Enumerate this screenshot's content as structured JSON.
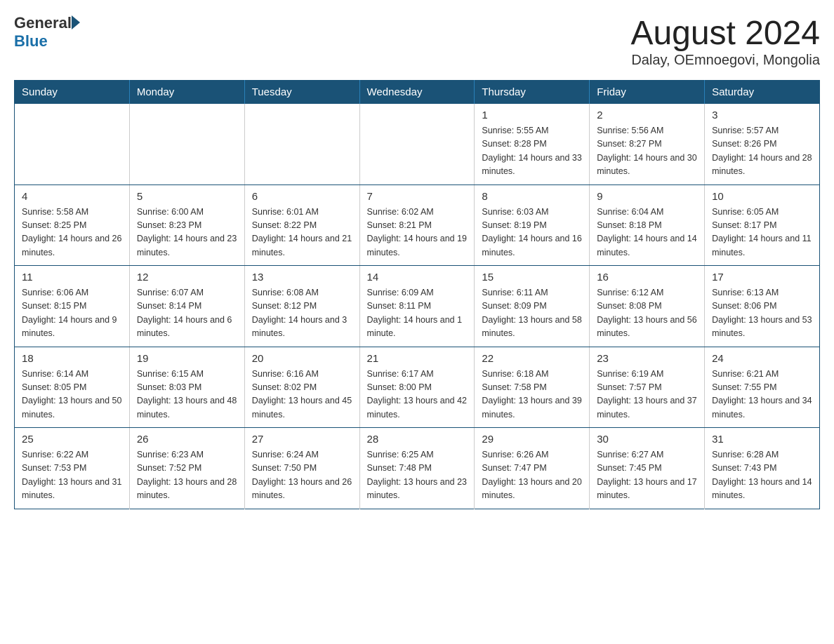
{
  "header": {
    "title": "August 2024",
    "subtitle": "Dalay, OEmnoegovi, Mongolia",
    "logo_general": "General",
    "logo_blue": "Blue"
  },
  "days_of_week": [
    "Sunday",
    "Monday",
    "Tuesday",
    "Wednesday",
    "Thursday",
    "Friday",
    "Saturday"
  ],
  "weeks": [
    [
      {
        "day": "",
        "info": ""
      },
      {
        "day": "",
        "info": ""
      },
      {
        "day": "",
        "info": ""
      },
      {
        "day": "",
        "info": ""
      },
      {
        "day": "1",
        "info": "Sunrise: 5:55 AM\nSunset: 8:28 PM\nDaylight: 14 hours and 33 minutes."
      },
      {
        "day": "2",
        "info": "Sunrise: 5:56 AM\nSunset: 8:27 PM\nDaylight: 14 hours and 30 minutes."
      },
      {
        "day": "3",
        "info": "Sunrise: 5:57 AM\nSunset: 8:26 PM\nDaylight: 14 hours and 28 minutes."
      }
    ],
    [
      {
        "day": "4",
        "info": "Sunrise: 5:58 AM\nSunset: 8:25 PM\nDaylight: 14 hours and 26 minutes."
      },
      {
        "day": "5",
        "info": "Sunrise: 6:00 AM\nSunset: 8:23 PM\nDaylight: 14 hours and 23 minutes."
      },
      {
        "day": "6",
        "info": "Sunrise: 6:01 AM\nSunset: 8:22 PM\nDaylight: 14 hours and 21 minutes."
      },
      {
        "day": "7",
        "info": "Sunrise: 6:02 AM\nSunset: 8:21 PM\nDaylight: 14 hours and 19 minutes."
      },
      {
        "day": "8",
        "info": "Sunrise: 6:03 AM\nSunset: 8:19 PM\nDaylight: 14 hours and 16 minutes."
      },
      {
        "day": "9",
        "info": "Sunrise: 6:04 AM\nSunset: 8:18 PM\nDaylight: 14 hours and 14 minutes."
      },
      {
        "day": "10",
        "info": "Sunrise: 6:05 AM\nSunset: 8:17 PM\nDaylight: 14 hours and 11 minutes."
      }
    ],
    [
      {
        "day": "11",
        "info": "Sunrise: 6:06 AM\nSunset: 8:15 PM\nDaylight: 14 hours and 9 minutes."
      },
      {
        "day": "12",
        "info": "Sunrise: 6:07 AM\nSunset: 8:14 PM\nDaylight: 14 hours and 6 minutes."
      },
      {
        "day": "13",
        "info": "Sunrise: 6:08 AM\nSunset: 8:12 PM\nDaylight: 14 hours and 3 minutes."
      },
      {
        "day": "14",
        "info": "Sunrise: 6:09 AM\nSunset: 8:11 PM\nDaylight: 14 hours and 1 minute."
      },
      {
        "day": "15",
        "info": "Sunrise: 6:11 AM\nSunset: 8:09 PM\nDaylight: 13 hours and 58 minutes."
      },
      {
        "day": "16",
        "info": "Sunrise: 6:12 AM\nSunset: 8:08 PM\nDaylight: 13 hours and 56 minutes."
      },
      {
        "day": "17",
        "info": "Sunrise: 6:13 AM\nSunset: 8:06 PM\nDaylight: 13 hours and 53 minutes."
      }
    ],
    [
      {
        "day": "18",
        "info": "Sunrise: 6:14 AM\nSunset: 8:05 PM\nDaylight: 13 hours and 50 minutes."
      },
      {
        "day": "19",
        "info": "Sunrise: 6:15 AM\nSunset: 8:03 PM\nDaylight: 13 hours and 48 minutes."
      },
      {
        "day": "20",
        "info": "Sunrise: 6:16 AM\nSunset: 8:02 PM\nDaylight: 13 hours and 45 minutes."
      },
      {
        "day": "21",
        "info": "Sunrise: 6:17 AM\nSunset: 8:00 PM\nDaylight: 13 hours and 42 minutes."
      },
      {
        "day": "22",
        "info": "Sunrise: 6:18 AM\nSunset: 7:58 PM\nDaylight: 13 hours and 39 minutes."
      },
      {
        "day": "23",
        "info": "Sunrise: 6:19 AM\nSunset: 7:57 PM\nDaylight: 13 hours and 37 minutes."
      },
      {
        "day": "24",
        "info": "Sunrise: 6:21 AM\nSunset: 7:55 PM\nDaylight: 13 hours and 34 minutes."
      }
    ],
    [
      {
        "day": "25",
        "info": "Sunrise: 6:22 AM\nSunset: 7:53 PM\nDaylight: 13 hours and 31 minutes."
      },
      {
        "day": "26",
        "info": "Sunrise: 6:23 AM\nSunset: 7:52 PM\nDaylight: 13 hours and 28 minutes."
      },
      {
        "day": "27",
        "info": "Sunrise: 6:24 AM\nSunset: 7:50 PM\nDaylight: 13 hours and 26 minutes."
      },
      {
        "day": "28",
        "info": "Sunrise: 6:25 AM\nSunset: 7:48 PM\nDaylight: 13 hours and 23 minutes."
      },
      {
        "day": "29",
        "info": "Sunrise: 6:26 AM\nSunset: 7:47 PM\nDaylight: 13 hours and 20 minutes."
      },
      {
        "day": "30",
        "info": "Sunrise: 6:27 AM\nSunset: 7:45 PM\nDaylight: 13 hours and 17 minutes."
      },
      {
        "day": "31",
        "info": "Sunrise: 6:28 AM\nSunset: 7:43 PM\nDaylight: 13 hours and 14 minutes."
      }
    ]
  ]
}
